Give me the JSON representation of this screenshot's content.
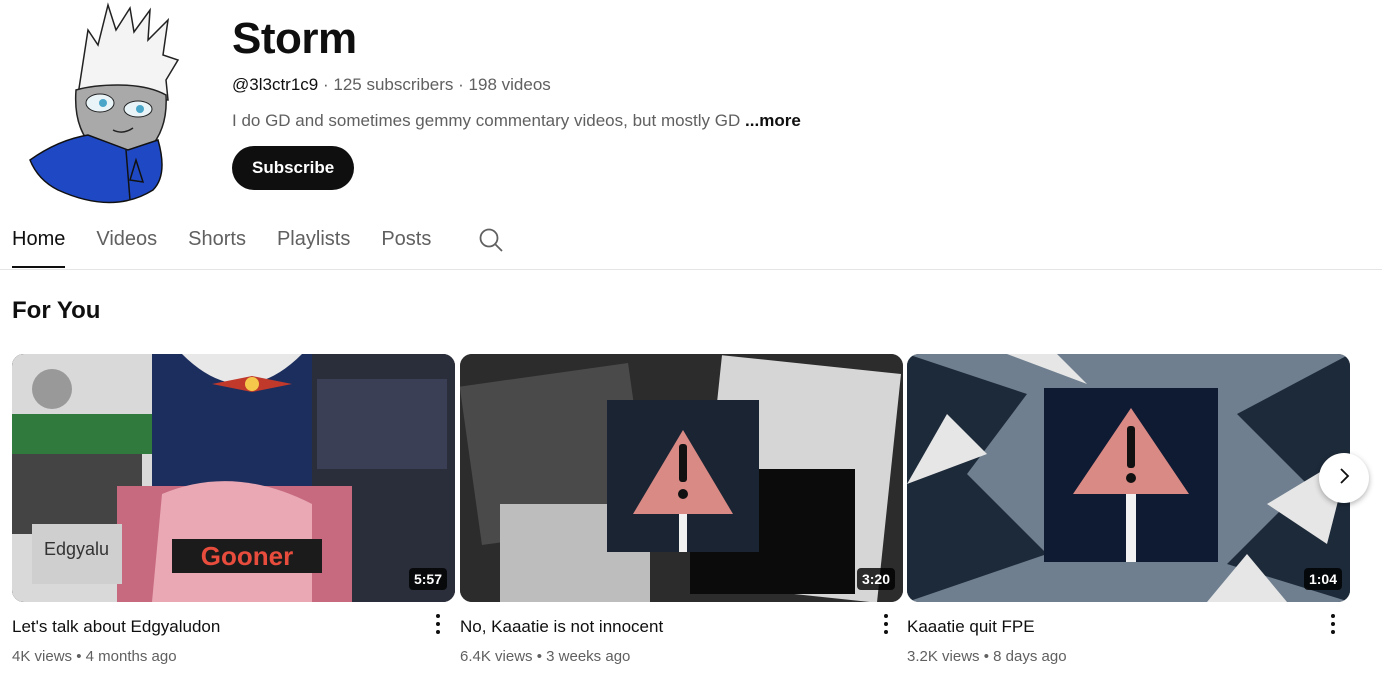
{
  "channel": {
    "name": "Storm",
    "handle": "@3l3ctr1c9",
    "subscribers": "125 subscribers",
    "videos_count": "198 videos",
    "separator": "·",
    "description": "I do GD and sometimes gemmy commentary videos, but mostly GD",
    "more_label": "...more",
    "subscribe_label": "Subscribe"
  },
  "tabs": [
    {
      "label": "Home",
      "active": true
    },
    {
      "label": "Videos",
      "active": false
    },
    {
      "label": "Shorts",
      "active": false
    },
    {
      "label": "Playlists",
      "active": false
    },
    {
      "label": "Posts",
      "active": false
    }
  ],
  "section": {
    "title": "For You"
  },
  "videos": [
    {
      "title": "Let's talk about Edgyaludon",
      "views": "4K views",
      "age": "4 months ago",
      "duration": "5:57",
      "overlay_text": "Gooner",
      "overlay_name": "Edgyalu"
    },
    {
      "title": "No, Kaaatie is not innocent",
      "views": "6.4K views",
      "age": "3 weeks ago",
      "duration": "3:20"
    },
    {
      "title": "Kaaatie quit FPE",
      "views": "3.2K views",
      "age": "8 days ago",
      "duration": "1:04"
    }
  ],
  "meta_dot": "•",
  "icons": {
    "search": "search-icon",
    "more": "more-vert-icon",
    "next": "chevron-right-icon"
  },
  "colors": {
    "subscribe_bg": "#0f0f0f",
    "text_secondary": "#606060",
    "warning_triangle": "#d98a84"
  }
}
